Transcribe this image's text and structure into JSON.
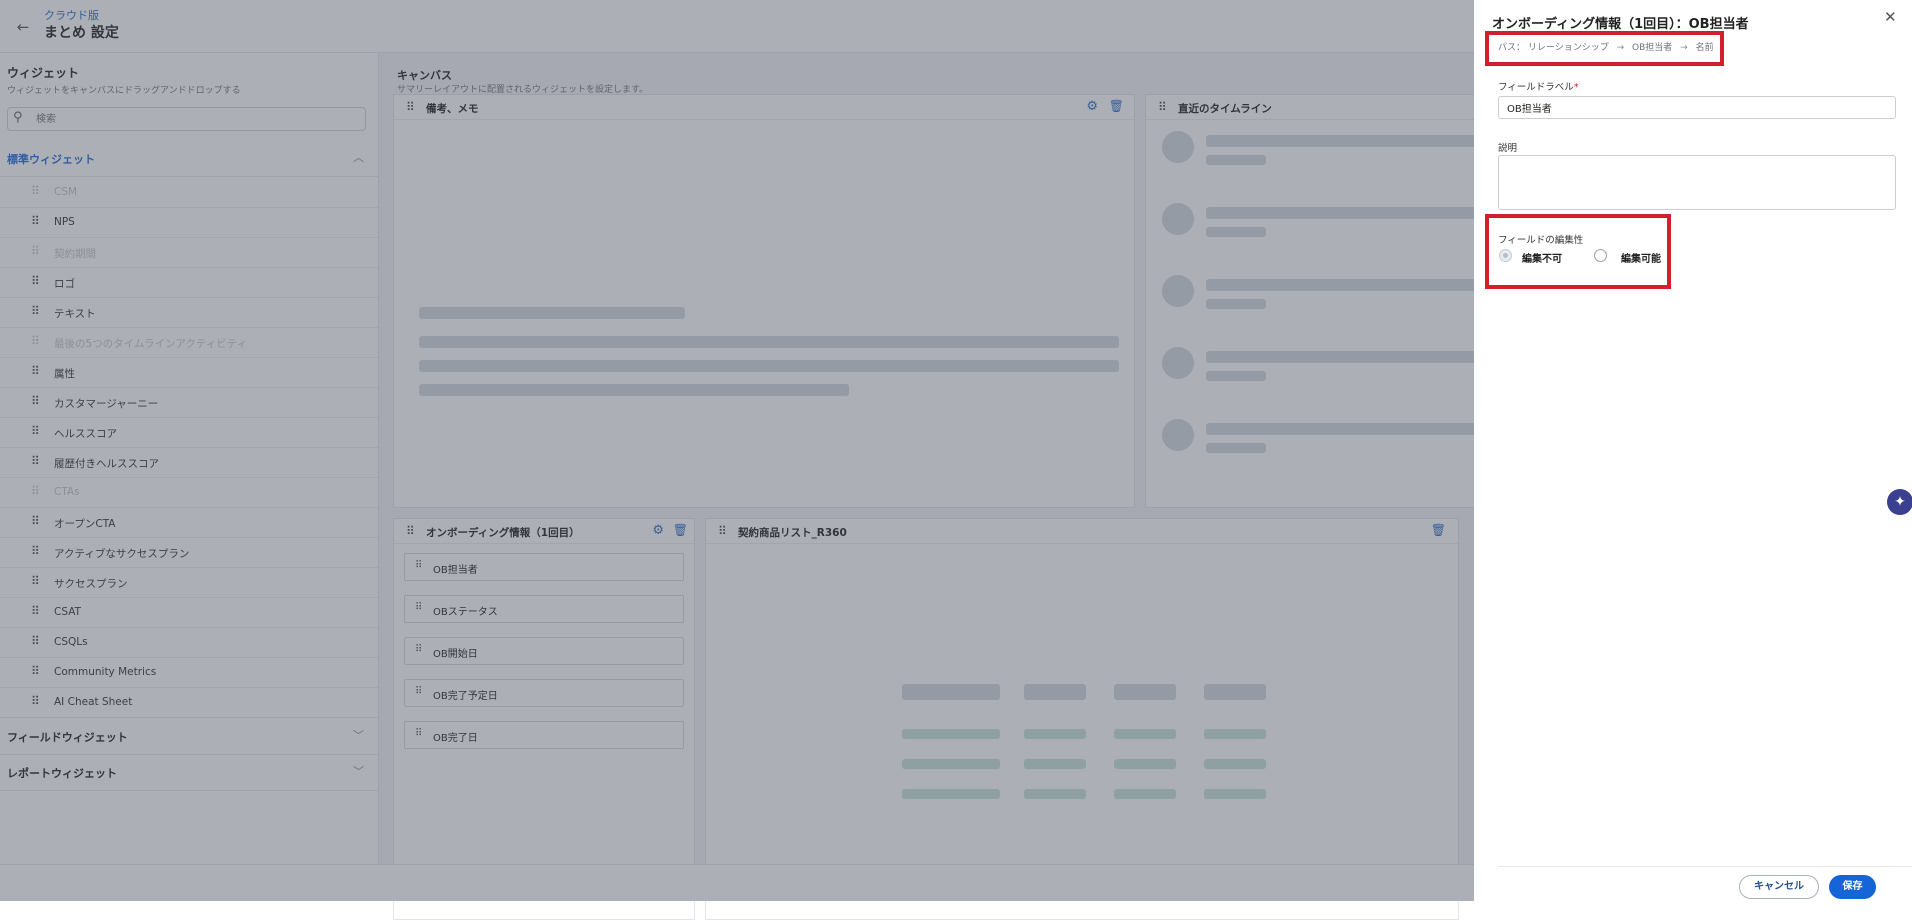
{
  "header": {
    "edition": "クラウド版",
    "title": "まとめ 設定"
  },
  "left_panel": {
    "title": "ウィジェット",
    "subtitle": "ウィジェットをキャンバスにドラッグアンドドロップする",
    "search_placeholder": "検索",
    "standard_section": "標準ウィジェット",
    "items": [
      {
        "label": "CSM",
        "disabled": true
      },
      {
        "label": "NPS",
        "disabled": false
      },
      {
        "label": "契約期間",
        "disabled": true
      },
      {
        "label": "ロゴ",
        "disabled": false
      },
      {
        "label": "テキスト",
        "disabled": false
      },
      {
        "label": "最後の5つのタイムラインアクティビティ",
        "disabled": true
      },
      {
        "label": "属性",
        "disabled": false
      },
      {
        "label": "カスタマージャーニー",
        "disabled": false
      },
      {
        "label": "ヘルススコア",
        "disabled": false
      },
      {
        "label": "履歴付きヘルススコア",
        "disabled": false
      },
      {
        "label": "CTAs",
        "disabled": true
      },
      {
        "label": "オープンCTA",
        "disabled": false
      },
      {
        "label": "アクティブなサクセスプラン",
        "disabled": false
      },
      {
        "label": "サクセスプラン",
        "disabled": false
      },
      {
        "label": "CSAT",
        "disabled": false
      },
      {
        "label": "CSQLs",
        "disabled": false
      },
      {
        "label": "Community Metrics",
        "disabled": false
      },
      {
        "label": "AI Cheat Sheet",
        "disabled": false
      }
    ],
    "field_section": "フィールドウィジェット",
    "report_section": "レポートウィジェット"
  },
  "canvas": {
    "title": "キャンバス",
    "subtitle": "サマリーレイアウトに配置されるウィジェットを設定します。",
    "notes_widget": "備考、メモ",
    "timeline_widget": "直近のタイムライン",
    "onboarding_widget": "オンボーディング情報（1回目）",
    "onboarding_fields": [
      "OB担当者",
      "OBステータス",
      "OB開始日",
      "OB完了予定日",
      "OB完了日"
    ],
    "contract_widget": "契約商品リスト_R360"
  },
  "drawer": {
    "title": "オンボーディング情報（1回目）：OB担当者",
    "breadcrumb": {
      "prefix": "パス：",
      "items": [
        "リレーションシップ",
        "OB担当者",
        "名前"
      ]
    },
    "field_label_title": "フィールドラベル",
    "required_mark": "*",
    "field_label_value": "OB担当者",
    "description_title": "説明",
    "editability_title": "フィールドの編集性",
    "option_not_editable": "編集不可",
    "option_editable": "編集可能",
    "selected_option": "編集不可",
    "cancel_label": "キャンセル",
    "save_label": "保存"
  },
  "colors": {
    "accent": "#1565d8",
    "highlight": "#d0202e",
    "required": "#d0202e"
  },
  "icons": [
    "back-arrow-icon",
    "search-icon",
    "chevron-up-icon",
    "chevron-down-icon",
    "drag-handle-icon",
    "gear-icon",
    "trash-icon",
    "close-icon",
    "arrow-right-icon",
    "ai-sparkle-icon"
  ]
}
